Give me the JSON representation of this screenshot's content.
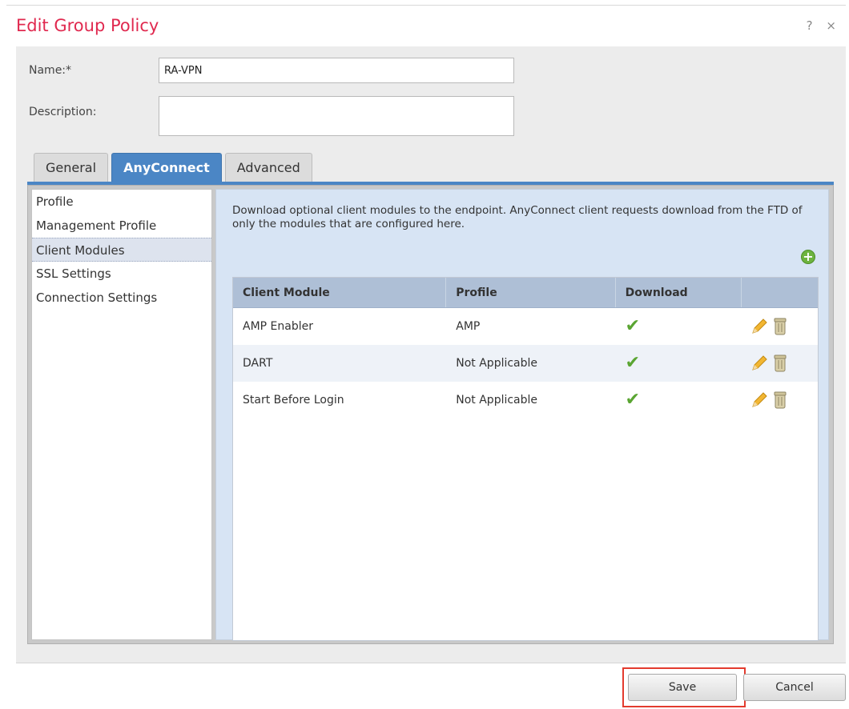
{
  "dialog": {
    "title": "Edit Group Policy",
    "help": "?",
    "close": "×"
  },
  "form": {
    "name_label": "Name:*",
    "name_value": "RA-VPN",
    "description_label": "Description:",
    "description_value": ""
  },
  "tabs": [
    {
      "label": "General",
      "active": false
    },
    {
      "label": "AnyConnect",
      "active": true
    },
    {
      "label": "Advanced",
      "active": false
    }
  ],
  "sidebar": {
    "items": [
      {
        "label": "Profile"
      },
      {
        "label": "Management Profile"
      },
      {
        "label": "Client Modules",
        "active": true
      },
      {
        "label": "SSL Settings"
      },
      {
        "label": "Connection Settings"
      }
    ]
  },
  "content": {
    "description": "Download optional client modules to the endpoint. AnyConnect client requests download from the FTD of only the modules that are configured here.",
    "add_icon": "plus",
    "table": {
      "columns": [
        "Client Module",
        "Profile",
        "Download",
        ""
      ],
      "rows": [
        {
          "module": "AMP Enabler",
          "profile": "AMP",
          "download": "✔"
        },
        {
          "module": "DART",
          "profile": "Not Applicable",
          "download": "✔"
        },
        {
          "module": "Start Before Login",
          "profile": "Not Applicable",
          "download": "✔"
        }
      ]
    }
  },
  "footer": {
    "save_label": "Save",
    "cancel_label": "Cancel"
  },
  "colors": {
    "title": "#e0294f",
    "tab_active": "#4b86c5",
    "check": "#5aa532",
    "highlight": "#e33b2e"
  }
}
